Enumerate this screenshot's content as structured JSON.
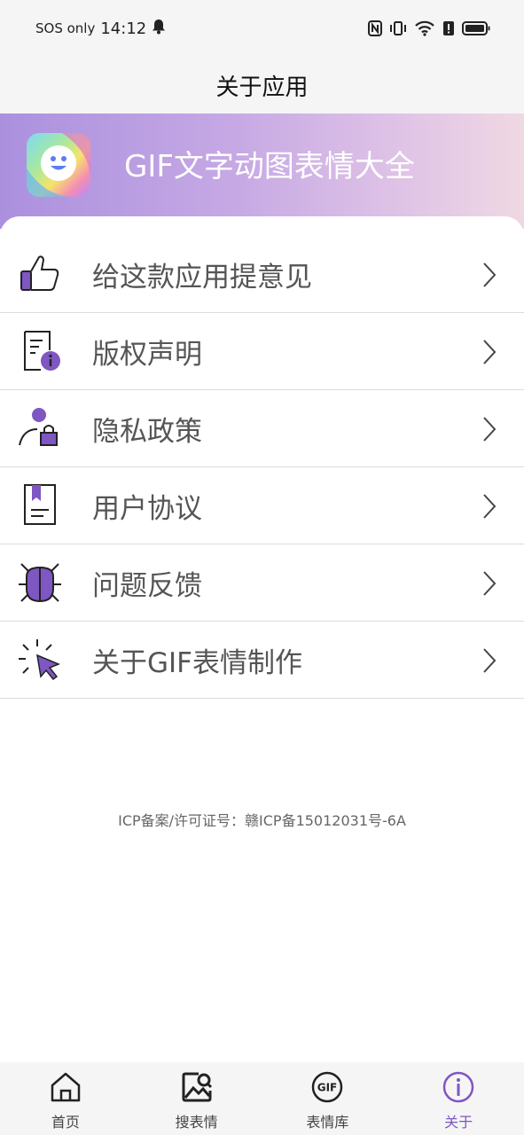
{
  "status_bar": {
    "carrier": "SOS only",
    "time": "14:12",
    "nfc_icon": "nfc-icon",
    "battery_icon": "battery-icon"
  },
  "header": {
    "title": "关于应用"
  },
  "banner": {
    "app_name": "GIF文字动图表情大全"
  },
  "menu": [
    {
      "label": "给这款应用提意见",
      "icon": "thumbs-up-icon"
    },
    {
      "label": "版权声明",
      "icon": "document-info-icon"
    },
    {
      "label": "隐私政策",
      "icon": "user-lock-icon"
    },
    {
      "label": "用户协议",
      "icon": "bookmark-document-icon"
    },
    {
      "label": "问题反馈",
      "icon": "bug-icon"
    },
    {
      "label": "关于GIF表情制作",
      "icon": "cursor-click-icon"
    }
  ],
  "footer": {
    "icp": "ICP备案/许可证号：赣ICP备15012031号-6A"
  },
  "bottom_nav": [
    {
      "label": "首页",
      "icon": "home-icon",
      "active": false
    },
    {
      "label": "搜表情",
      "icon": "image-search-icon",
      "active": false
    },
    {
      "label": "表情库",
      "icon": "gif-icon",
      "active": false
    },
    {
      "label": "关于",
      "icon": "info-icon",
      "active": true
    }
  ],
  "colors": {
    "accent": "#7e57c2",
    "icon_fill": "#7e57c2",
    "banner_start": "#ab90df",
    "banner_end": "#f0d8e2"
  }
}
